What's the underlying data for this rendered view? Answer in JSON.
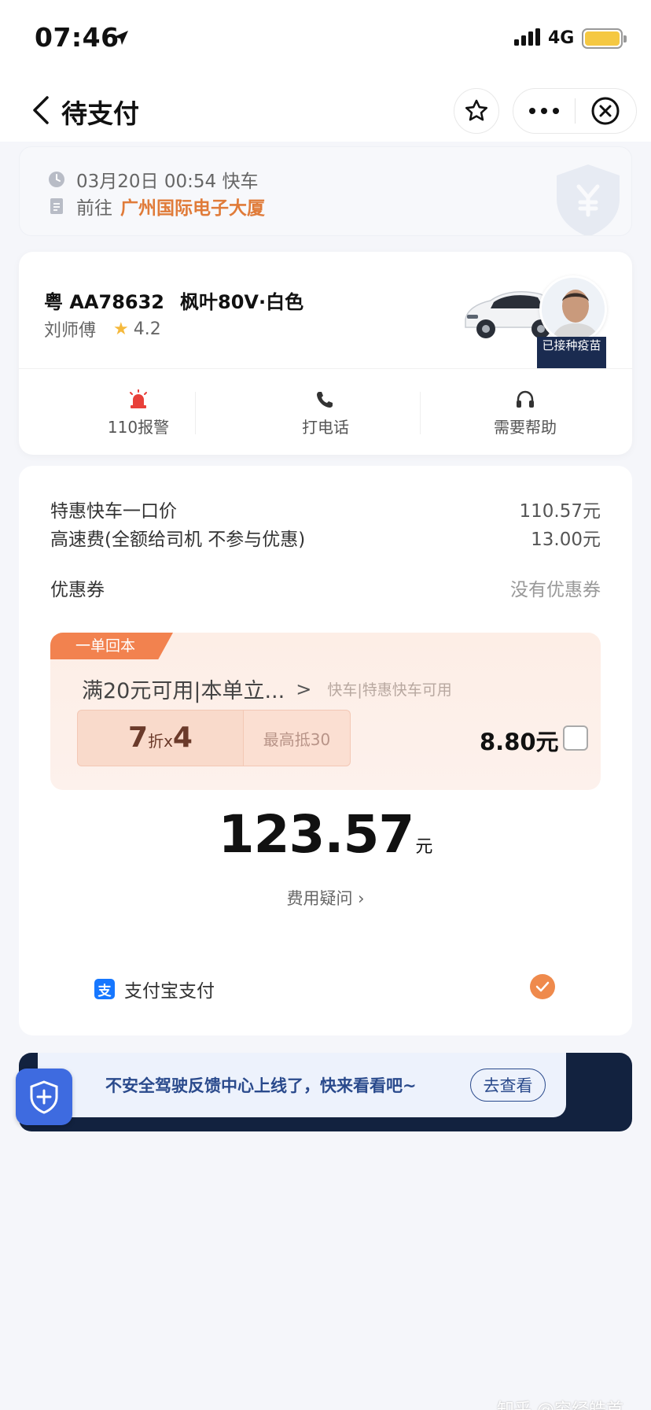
{
  "status_bar": {
    "time": "07:46",
    "network": "4G",
    "battery_level": 0.9,
    "battery_color": "#f5c842"
  },
  "nav": {
    "title": "待支付",
    "icons": [
      "back-chevron-icon",
      "star-icon",
      "more-icon",
      "close-circle-icon"
    ]
  },
  "trip": {
    "time_text": "03月20日 00:54 快车",
    "dest_prefix": "前往",
    "destination": "广州国际电子大厦"
  },
  "driver": {
    "plate": "粤 AA78632",
    "car": "枫叶80V·白色",
    "name": "刘师傅",
    "rating": "4.2",
    "vaccine_badge": "已接种疫苗",
    "actions": [
      {
        "label": "110报警",
        "icon": "alarm-siren-icon"
      },
      {
        "label": "打电话",
        "icon": "phone-icon"
      },
      {
        "label": "需要帮助",
        "icon": "headset-icon"
      }
    ]
  },
  "payment": {
    "fees": [
      {
        "label": "特惠快车一口价",
        "value": "110.57元"
      },
      {
        "label": "高速费(全额给司机 不参与优惠)",
        "value": "13.00元"
      }
    ],
    "coupon_label": "优惠券",
    "coupon_value": "没有优惠券",
    "voucher": {
      "tag": "一单回本",
      "title": "满20元可用|本单立...",
      "scope": "快车|特惠快车可用",
      "discount_num": "7",
      "discount_unit": "折x",
      "discount_count": "4",
      "cap": "最高抵30",
      "amount": "8.80元",
      "checked": false
    },
    "total": "123.57",
    "total_unit": "元",
    "fee_question": "费用疑问 ›",
    "method": "支付宝支付",
    "method_icon_glyph": "支",
    "method_selected": true,
    "accent_color": "#ef8a4c"
  },
  "banner": {
    "text": "不安全驾驶反馈中心上线了，快来看看吧~",
    "button": "去查看"
  },
  "watermark": "知乎 @穷经皓首"
}
